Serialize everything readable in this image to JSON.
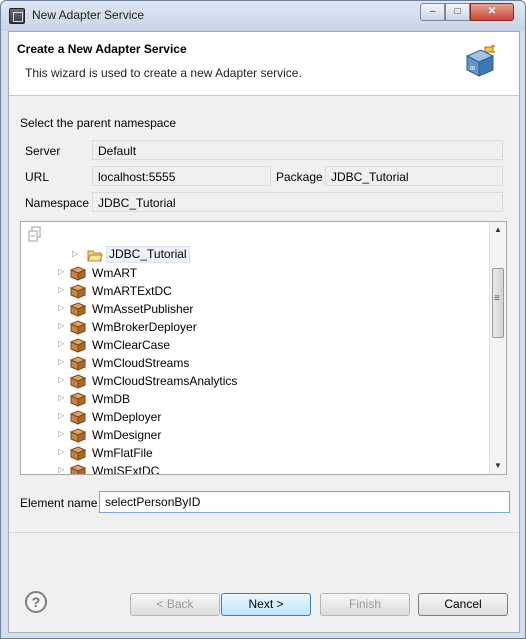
{
  "window": {
    "title": "New Adapter Service",
    "controls": {
      "minimize": "–",
      "maximize": "□",
      "close": "✕"
    }
  },
  "header": {
    "title": "Create a New Adapter Service",
    "description": "This wizard is used to create a new Adapter service.",
    "icon": "adapter-plug-icon"
  },
  "namespace": {
    "section_label": "Select the parent namespace",
    "server_label": "Server",
    "server_value": "Default",
    "url_label": "URL",
    "url_value": "localhost:5555",
    "package_label": "Package",
    "package_value": "JDBC_Tutorial",
    "namespace_label": "Namespace",
    "namespace_value": "JDBC_Tutorial"
  },
  "tree": {
    "toolbar_icon": "collapse-tree-icon",
    "selected": {
      "label": "JDBC_Tutorial",
      "icon": "open-folder-icon"
    },
    "packages": [
      "WmART",
      "WmARTExtDC",
      "WmAssetPublisher",
      "WmBrokerDeployer",
      "WmClearCase",
      "WmCloudStreams",
      "WmCloudStreamsAnalytics",
      "WmDB",
      "WmDeployer",
      "WmDesigner",
      "WmFlatFile",
      "WmISExtDC"
    ]
  },
  "element": {
    "label": "Element name",
    "value": "selectPersonByID"
  },
  "buttons": {
    "help": "?",
    "back": "< Back",
    "next": "Next >",
    "finish": "Finish",
    "cancel": "Cancel"
  },
  "colors": {
    "window_frame": "#d5dcea",
    "close_button": "#c8473a",
    "package_icon": "#c9823f",
    "folder_icon": "#e8c15a"
  }
}
